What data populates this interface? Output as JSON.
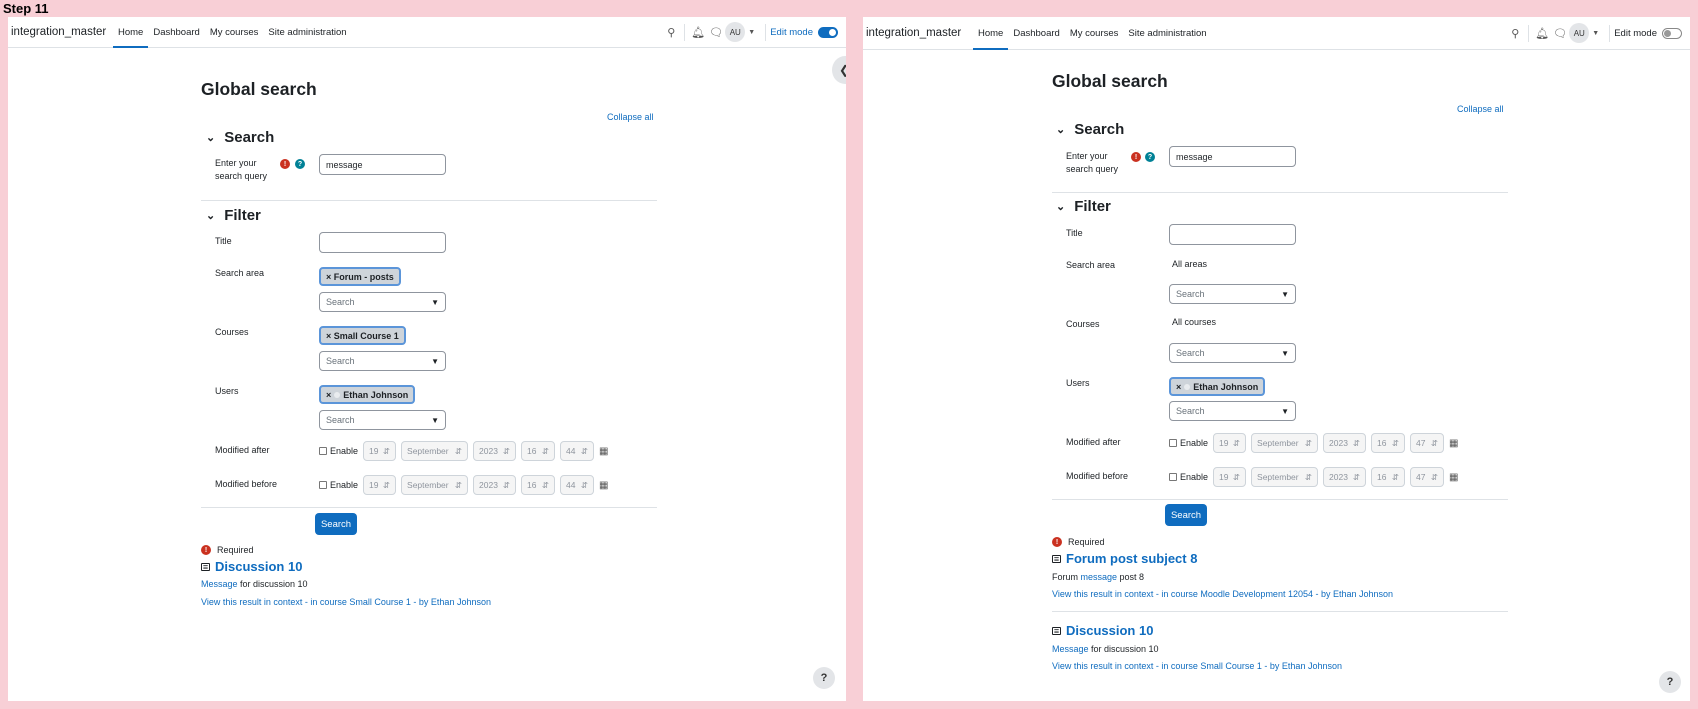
{
  "step_label": "Step 11",
  "left": {
    "brand": "integration_master",
    "nav": [
      "Home",
      "Dashboard",
      "My courses",
      "Site administration"
    ],
    "avatar": "AU",
    "edit_mode_label": "Edit mode",
    "edit_mode_on": true,
    "title": "Global search",
    "collapse_all": "Collapse all",
    "search_section": "Search",
    "query_label_1": "Enter your",
    "query_label_2": "search query",
    "query_value": "message",
    "filter_section": "Filter",
    "title_label": "Title",
    "search_area_label": "Search area",
    "search_area_chip": "Forum - posts",
    "courses_label": "Courses",
    "courses_chip": "Small Course 1",
    "users_label": "Users",
    "users_chip": "Ethan Johnson",
    "select_placeholder": "Search",
    "modified_after_label": "Modified after",
    "modified_before_label": "Modified before",
    "enable_label": "Enable",
    "day": "19",
    "month": "September",
    "year": "2023",
    "hour": "16",
    "minute": "44",
    "search_button": "Search",
    "required": "Required",
    "results": [
      {
        "title": "Discussion 10",
        "text_highlight": "Message",
        "text_rest": " for discussion 10",
        "link": "View this result in context - in course Small Course 1 - by Ethan Johnson"
      }
    ]
  },
  "right": {
    "brand": "integration_master",
    "nav": [
      "Home",
      "Dashboard",
      "My courses",
      "Site administration"
    ],
    "avatar": "AU",
    "edit_mode_label": "Edit mode",
    "edit_mode_on": false,
    "title": "Global search",
    "collapse_all": "Collapse all",
    "search_section": "Search",
    "query_label_1": "Enter your",
    "query_label_2": "search query",
    "query_value": "message",
    "filter_section": "Filter",
    "title_label": "Title",
    "search_area_label": "Search area",
    "search_area_value": "All areas",
    "courses_label": "Courses",
    "courses_value": "All courses",
    "users_label": "Users",
    "users_chip": "Ethan Johnson",
    "select_placeholder": "Search",
    "modified_after_label": "Modified after",
    "modified_before_label": "Modified before",
    "enable_label": "Enable",
    "day": "19",
    "month": "September",
    "year": "2023",
    "hour": "16",
    "minute": "47",
    "search_button": "Search",
    "required": "Required",
    "results": [
      {
        "title": "Forum post subject 8",
        "text_prefix": "Forum ",
        "text_highlight": "message",
        "text_rest": " post 8",
        "link": "View this result in context - in course Moodle Development 12054 - by Ethan Johnson"
      },
      {
        "title": "Discussion 10",
        "text_highlight": "Message",
        "text_rest": " for discussion 10",
        "link": "View this result in context - in course Small Course 1 - by Ethan Johnson"
      }
    ]
  }
}
